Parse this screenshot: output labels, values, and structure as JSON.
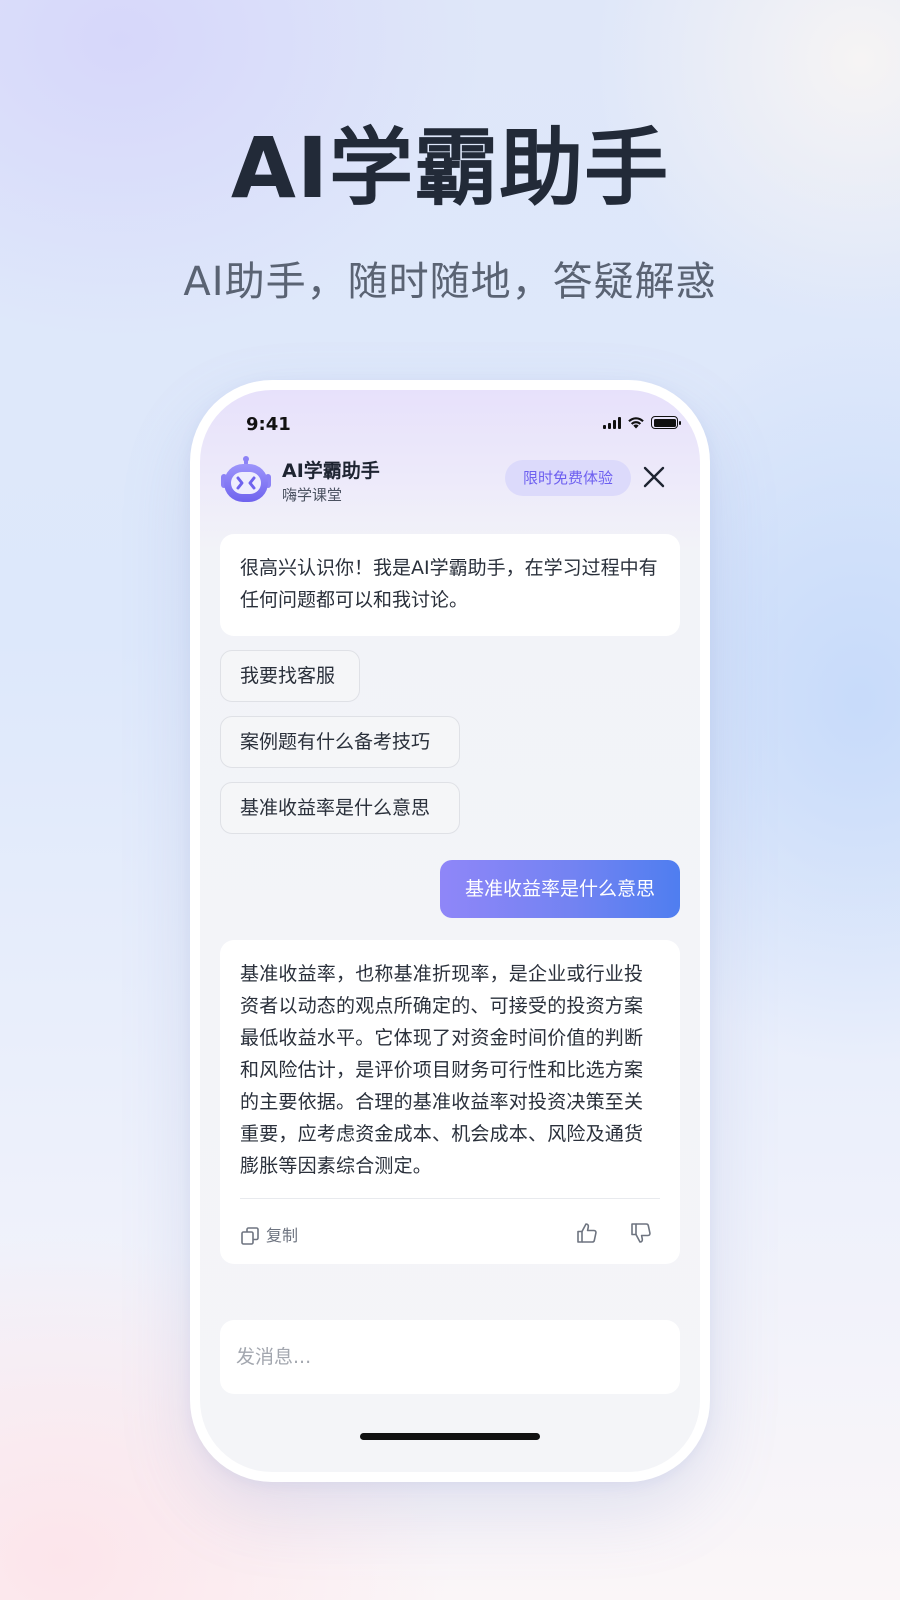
{
  "hero": {
    "title": "AI学霸助手",
    "subtitle": "AI助手，随时随地，答疑解惑"
  },
  "status_bar": {
    "time": "9:41",
    "icons": [
      "signal-icon",
      "wifi-icon",
      "battery-icon"
    ]
  },
  "header": {
    "app_name": "AI学霸助手",
    "app_subtitle": "嗨学课堂",
    "promo_badge": "限时免费体验",
    "close_icon": "close-icon"
  },
  "chat": {
    "greeting": "很高兴认识你！我是AI学霸助手，在学习过程中有任何问题都可以和我讨论。",
    "quick_replies": [
      "我要找客服",
      "案例题有什么备考技巧",
      "基准收益率是什么意思"
    ],
    "user_message": "基准收益率是什么意思",
    "answer": "基准收益率，也称基准折现率，是企业或行业投资者以动态的观点所确定的、可接受的投资方案最低收益水平。它体现了对资金时间价值的判断和风险估计，是评价项目财务可行性和比选方案的主要依据。合理的基准收益率对投资决策至关重要，应考虑资金成本、机会成本、风险及通货膨胀等因素综合测定。",
    "actions": {
      "copy_label": "复制",
      "like_icon": "thumbs-up-icon",
      "dislike_icon": "thumbs-down-icon"
    }
  },
  "input": {
    "placeholder": "发消息..."
  },
  "colors": {
    "accent": "#6d5ff0",
    "badge_bg": "#dcdafb",
    "user_bubble_start": "#8f86f8",
    "user_bubble_end": "#4f7ef0"
  }
}
